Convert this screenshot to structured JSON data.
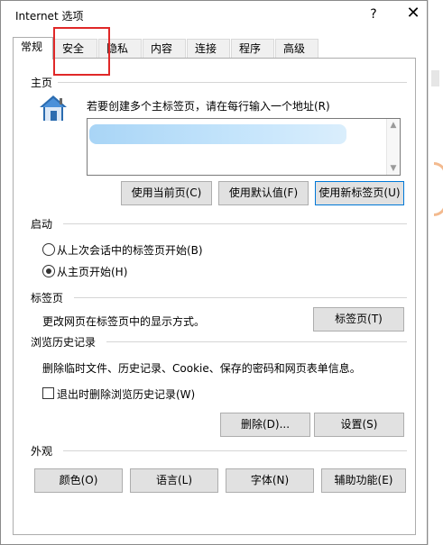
{
  "window": {
    "title": "Internet 选项",
    "help_glyph": "?",
    "close_glyph": "✕"
  },
  "tabs": [
    {
      "label": "常规",
      "active": true
    },
    {
      "label": "安全"
    },
    {
      "label": "隐私"
    },
    {
      "label": "内容"
    },
    {
      "label": "连接"
    },
    {
      "label": "程序"
    },
    {
      "label": "高级"
    }
  ],
  "home": {
    "header": "主页",
    "description": "若要创建多个主标签页，请在每行输入一个地址(R)",
    "url_value": "",
    "buttons": {
      "use_current": "使用当前页(C)",
      "use_default": "使用默认值(F)",
      "use_new_tab": "使用新标签页(U)"
    }
  },
  "startup": {
    "header": "启动",
    "option_last_session": "从上次会话中的标签页开始(B)",
    "option_home": "从主页开始(H)",
    "selected": "option_home"
  },
  "tabs_section": {
    "header": "标签页",
    "description": "更改网页在标签页中的显示方式。",
    "button": "标签页(T)"
  },
  "history": {
    "header": "浏览历史记录",
    "description": "删除临时文件、历史记录、Cookie、保存的密码和网页表单信息。",
    "checkbox_label": "退出时删除浏览历史记录(W)",
    "checkbox_checked": false,
    "delete_button": "删除(D)...",
    "settings_button": "设置(S)"
  },
  "appearance": {
    "header": "外观",
    "colors": "颜色(O)",
    "languages": "语言(L)",
    "fonts": "字体(N)",
    "accessibility": "辅助功能(E)"
  },
  "colors": {
    "accent": "#0078d7",
    "highlight_box": "#e02828"
  }
}
